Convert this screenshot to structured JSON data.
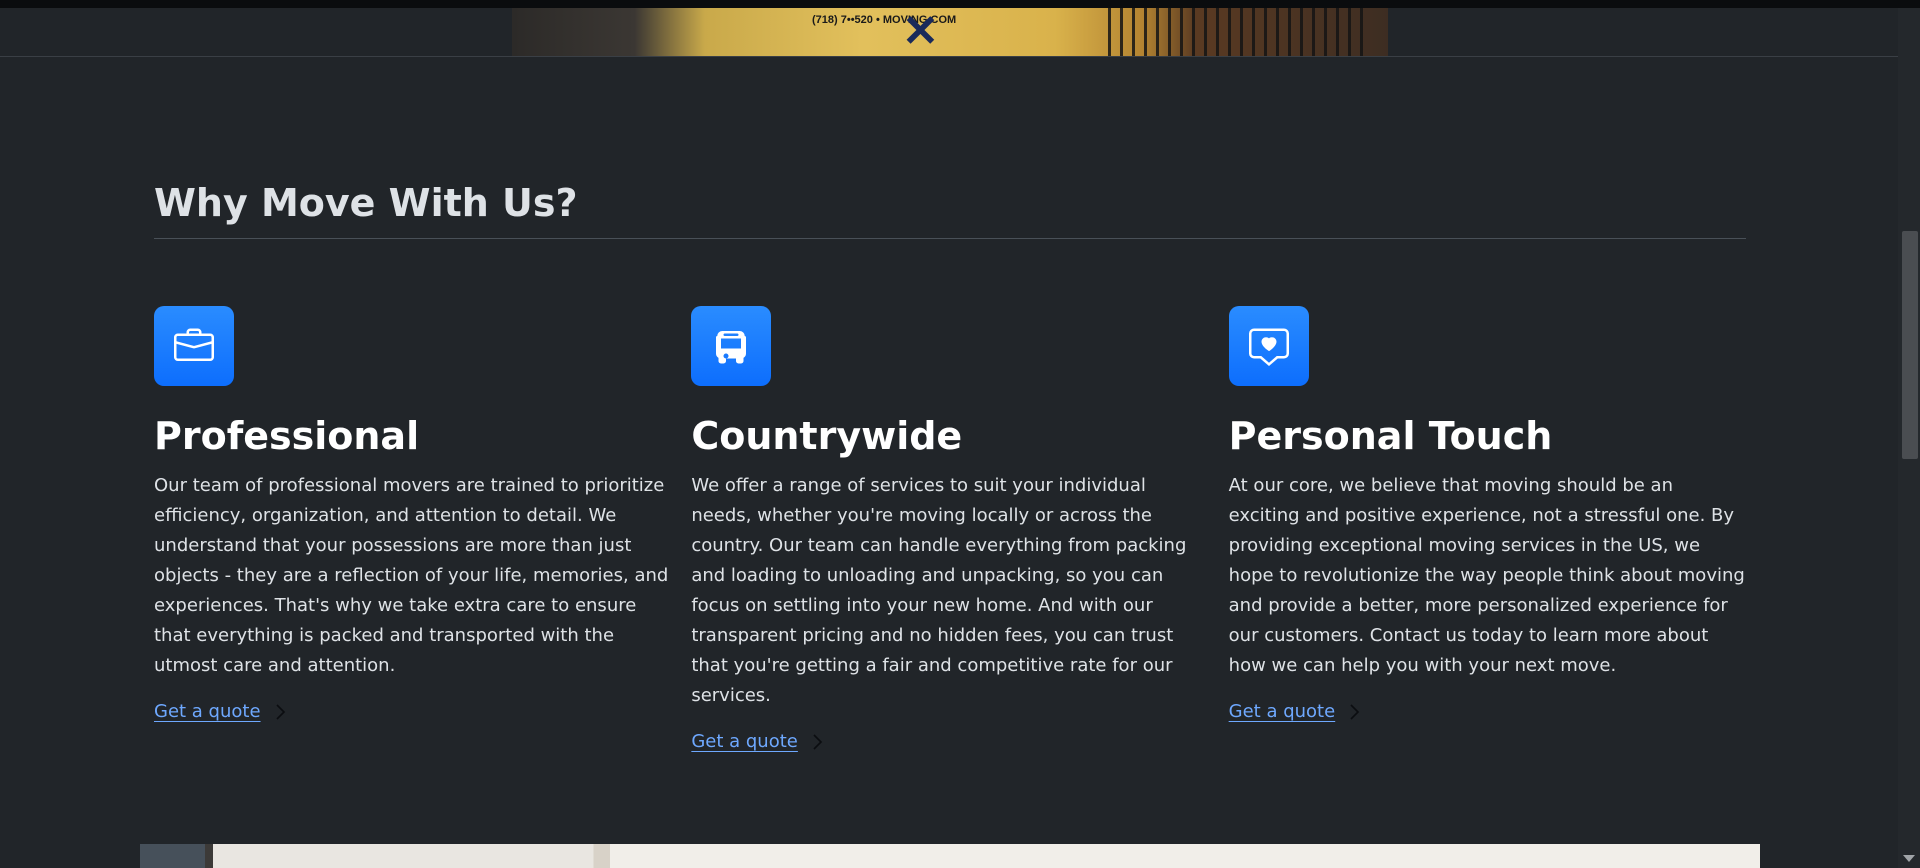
{
  "hero": {
    "truck_text": "(718) 7••520 • MOVING.COM"
  },
  "why": {
    "title": "Why Move With Us?"
  },
  "features": [
    {
      "icon": "briefcase-icon",
      "title": "Professional",
      "text": "Our team of professional movers are trained to prioritize efficiency, organization, and attention to detail. We understand that your possessions are more than just objects - they are a reflection of your life, memories, and experiences. That's why we take extra care to ensure that everything is packed and transported with the utmost care and attention.",
      "link_label": "Get a quote"
    },
    {
      "icon": "bus-icon",
      "title": "Countrywide",
      "text": "We offer a range of services to suit your individual needs, whether you're moving locally or across the country. Our team can handle everything from packing and loading to unloading and unpacking, so you can focus on settling into your new home. And with our transparent pricing and no hidden fees, you can trust that you're getting a fair and competitive rate for our services.",
      "link_label": "Get a quote"
    },
    {
      "icon": "chat-heart-icon",
      "title": "Personal Touch",
      "text": "At our core, we believe that moving should be an exciting and positive experience, not a stressful one. By providing exceptional moving services in the US, we hope to revolutionize the way people think about moving and provide a better, more personalized experience for our customers. Contact us today to learn more about how we can help you with your next move.",
      "link_label": "Get a quote"
    }
  ],
  "colors": {
    "background": "#212529",
    "accent": "#0d6efd",
    "link": "#6ea8fe"
  }
}
